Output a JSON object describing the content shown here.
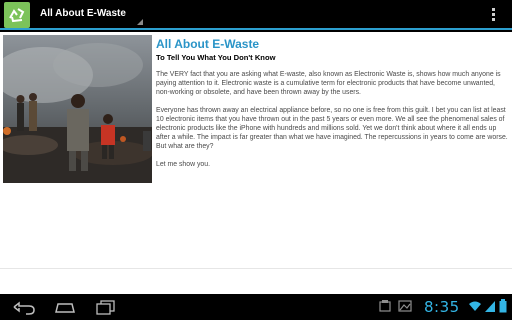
{
  "action_bar": {
    "title": "All About E-Waste",
    "icons": {
      "app": "recycle-icon",
      "overflow": "overflow-menu-icon"
    }
  },
  "article": {
    "title": "All About E-Waste",
    "subtitle": "To Tell You What You Don't Know",
    "paragraphs": [
      "The VERY fact that you are asking what E-waste, also known as Electronic Waste is, shows how much anyone is paying attention to it. Electronic waste is a cumulative term for electronic products that have become unwanted, non-working or obsolete, and have been thrown away by the users.",
      "Everyone has thrown away an electrical appliance before, so no one is free from this guilt. I bet you can list at least 10 electronic items that you have thrown out in the past 5 years or even more. We all see the phenomenal sales of electronic products like the iPhone with hundreds and millions sold. Yet we don't think about where it all ends up after a while. The impact is far greater than what we have imagined. The repercussions in years to come are worse. But what are they?",
      "Let me show you."
    ],
    "image_icon": "e-waste-dump-photo"
  },
  "system_bar": {
    "time": "8:35",
    "icons": [
      "back-icon",
      "home-icon",
      "recent-apps-icon",
      "screenshot-icon",
      "gallery-icon",
      "wifi-icon",
      "signal-icon",
      "battery-icon"
    ]
  },
  "colors": {
    "accent": "#2c9fcf",
    "title": "#2a94c7",
    "clock": "#33b5e5",
    "app_icon_bg": "#7cc35a"
  }
}
